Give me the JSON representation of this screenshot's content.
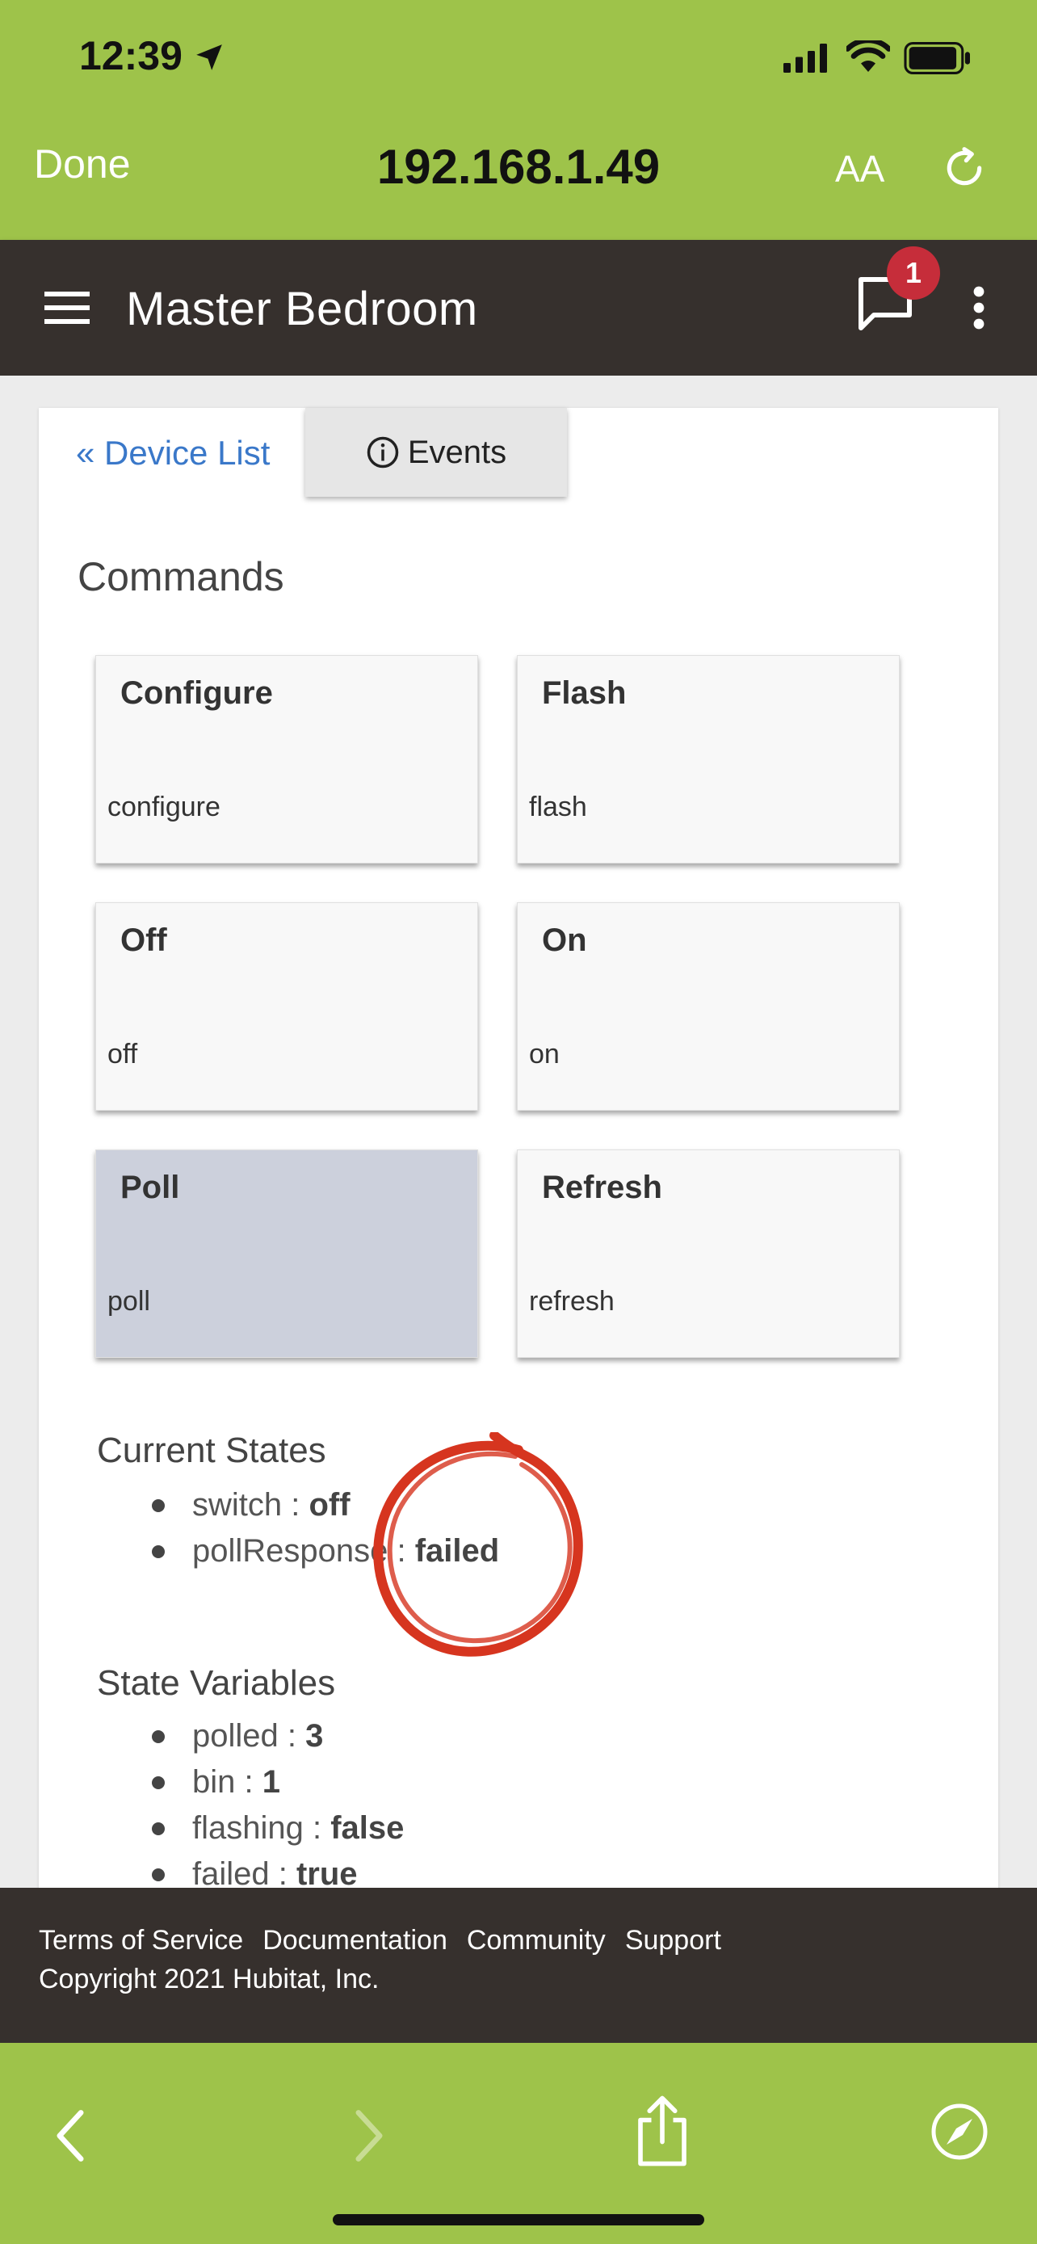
{
  "status_bar": {
    "time": "12:39"
  },
  "browser": {
    "done_label": "Done",
    "url": "192.168.1.49",
    "text_size_label": "AA"
  },
  "header": {
    "title": "Master Bedroom",
    "notification_count": "1"
  },
  "nav": {
    "device_list": "« Device List",
    "events": "Events"
  },
  "commands": {
    "title": "Commands",
    "items": [
      {
        "title": "Configure",
        "name": "configure"
      },
      {
        "title": "Flash",
        "name": "flash"
      },
      {
        "title": "Off",
        "name": "off"
      },
      {
        "title": "On",
        "name": "on"
      },
      {
        "title": "Poll",
        "name": "poll"
      },
      {
        "title": "Refresh",
        "name": "refresh"
      }
    ]
  },
  "current_states": {
    "title": "Current States",
    "items": [
      {
        "key": "switch",
        "value": "off"
      },
      {
        "key": "pollResponse",
        "value": "failed"
      }
    ]
  },
  "state_variables": {
    "title": "State Variables",
    "items": [
      {
        "key": "polled",
        "value": "3"
      },
      {
        "key": "bin",
        "value": "1"
      },
      {
        "key": "flashing",
        "value": "false"
      },
      {
        "key": "failed",
        "value": "true"
      }
    ]
  },
  "footer": {
    "links": [
      "Terms of Service",
      "Documentation",
      "Community",
      "Support"
    ],
    "copyright": "Copyright 2021 Hubitat, Inc."
  },
  "colors": {
    "browser_green": "#9ec34a",
    "header_dark": "#36302d",
    "link_blue": "#3a78c9",
    "badge_red": "#c62d3a",
    "annotation_red": "#d6351f",
    "active_command_bg": "#ccd0dc"
  },
  "icons": {
    "location": "location-arrow-icon",
    "signal": "cellular-signal-icon",
    "wifi": "wifi-icon",
    "battery": "battery-icon",
    "reload": "reload-icon",
    "menu": "hamburger-menu-icon",
    "messages": "chat-bubble-icon",
    "more": "kebab-menu-icon",
    "info": "info-icon",
    "back": "chevron-left-icon",
    "forward": "chevron-right-icon",
    "share": "share-icon",
    "compass": "compass-icon"
  }
}
